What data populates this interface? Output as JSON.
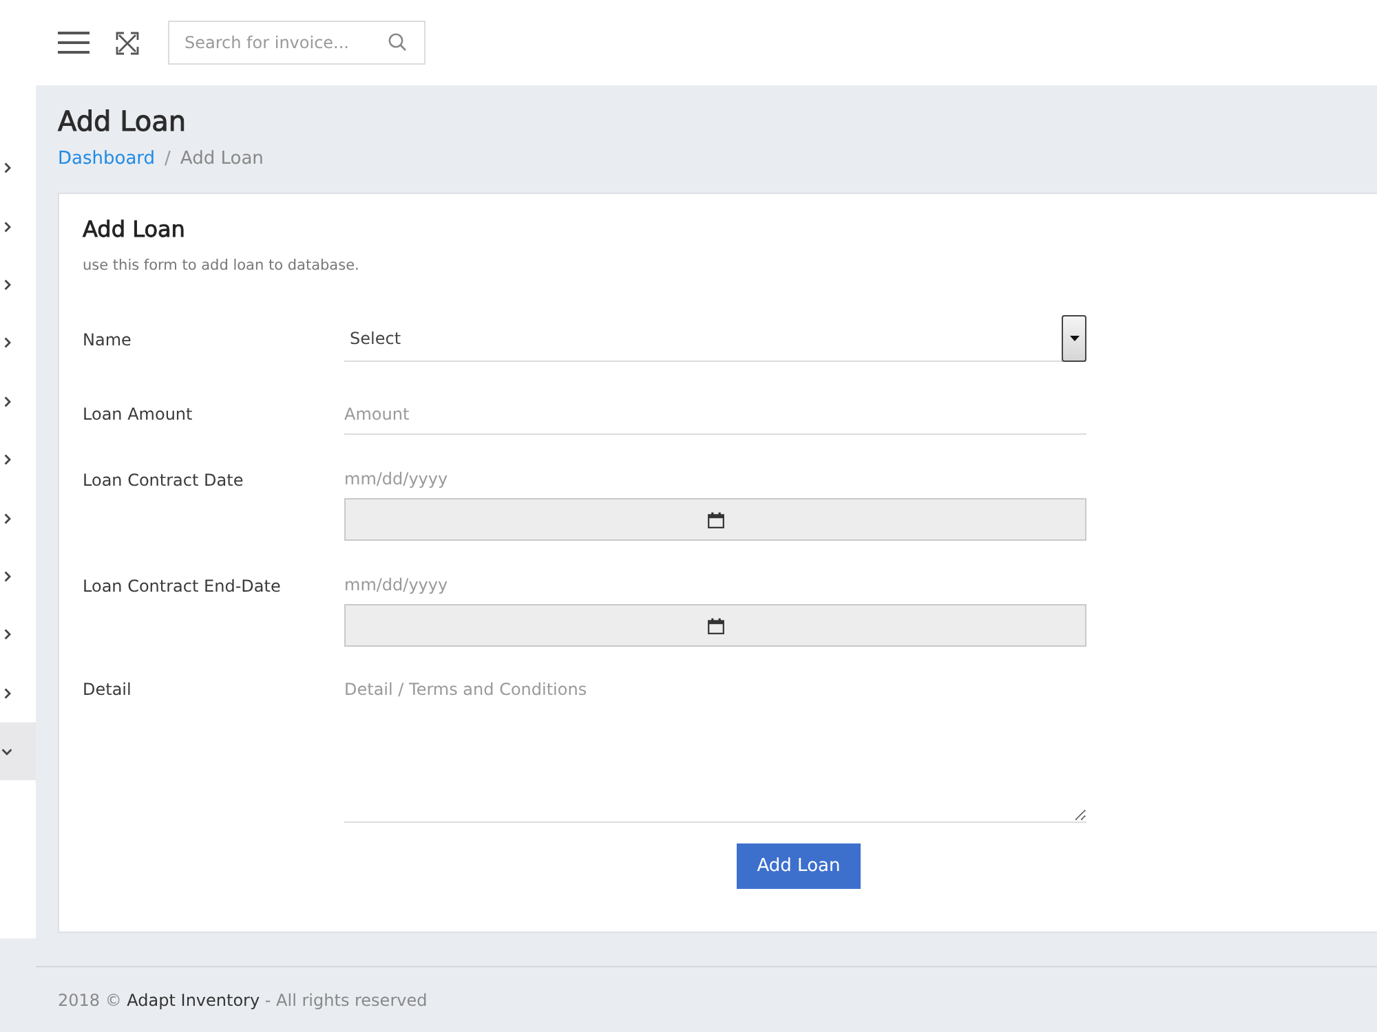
{
  "header": {
    "search": {
      "placeholder": "Search for invoice..."
    }
  },
  "sidebar": {
    "items": [
      {
        "expanded": false,
        "selected": false
      },
      {
        "expanded": false,
        "selected": false
      },
      {
        "expanded": false,
        "selected": false
      },
      {
        "expanded": false,
        "selected": false
      },
      {
        "expanded": false,
        "selected": false
      },
      {
        "expanded": false,
        "selected": false
      },
      {
        "expanded": false,
        "selected": false
      },
      {
        "expanded": false,
        "selected": false
      },
      {
        "expanded": false,
        "selected": false
      },
      {
        "expanded": false,
        "selected": false
      },
      {
        "expanded": true,
        "selected": true
      }
    ]
  },
  "page": {
    "title": "Add Loan",
    "breadcrumb": {
      "separator": "/",
      "items": [
        {
          "label": "Dashboard",
          "current": false
        },
        {
          "label": "Add Loan",
          "current": true
        }
      ]
    }
  },
  "form": {
    "title": "Add Loan",
    "subtitle": "use this form to add loan to database.",
    "fields": [
      {
        "kind": "select",
        "label": "Name",
        "value": "Select"
      },
      {
        "kind": "text",
        "label": "Loan Amount",
        "placeholder": "Amount"
      },
      {
        "kind": "date",
        "label": "Loan Contract Date",
        "placeholder": "mm/dd/yyyy"
      },
      {
        "kind": "date",
        "label": "Loan Contract End-Date",
        "placeholder": "mm/dd/yyyy"
      },
      {
        "kind": "textarea",
        "label": "Detail",
        "placeholder": "Detail / Terms and Conditions"
      }
    ],
    "submit": "Add Loan"
  },
  "footer": {
    "prefix": "2018 ©",
    "link": "Adapt Inventory",
    "suffix": "- All rights reserved"
  }
}
